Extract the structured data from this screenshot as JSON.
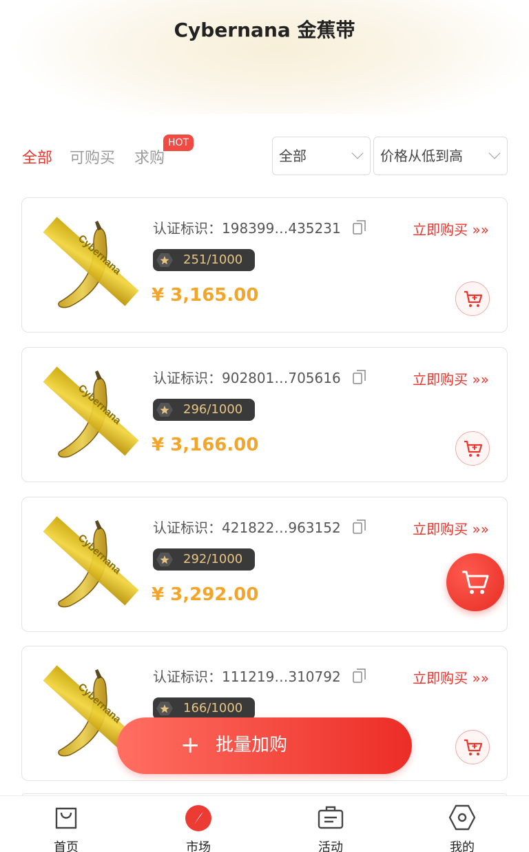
{
  "header": {
    "title": "Cybernana 金蕉带"
  },
  "tabs": [
    {
      "label": "全部",
      "active": true
    },
    {
      "label": "可购买",
      "active": false
    },
    {
      "label": "求购",
      "active": false,
      "badge": "HOT"
    }
  ],
  "filters": {
    "category": {
      "selected": "全部"
    },
    "sort": {
      "selected": "价格从低到高"
    }
  },
  "listings": [
    {
      "cert_label": "认证标识：",
      "cert_id": "198399…435231",
      "edition": "251/1000",
      "price": "¥ 3,165.00",
      "buy_label": "立即购买"
    },
    {
      "cert_label": "认证标识：",
      "cert_id": "902801…705616",
      "edition": "296/1000",
      "price": "¥ 3,166.00",
      "buy_label": "立即购买"
    },
    {
      "cert_label": "认证标识：",
      "cert_id": "421822…963152",
      "edition": "292/1000",
      "price": "¥ 3,292.00",
      "buy_label": "立即购买"
    },
    {
      "cert_label": "认证标识：",
      "cert_id": "111219…310792",
      "edition": "166/1000",
      "price": "",
      "buy_label": "立即购买"
    }
  ],
  "banana_text": "Cybernana",
  "batch_button": {
    "plus": "+",
    "label": "批量加购"
  },
  "nav": [
    {
      "label": "首页",
      "icon": "bag-icon"
    },
    {
      "label": "市场",
      "icon": "compass-icon",
      "active": true
    },
    {
      "label": "活动",
      "icon": "briefcase-icon"
    },
    {
      "label": "我的",
      "icon": "hexagon-icon"
    }
  ],
  "colors": {
    "accent": "#e8362f",
    "price": "#f3a52a",
    "badge_bg": "#3a3a3a",
    "badge_text": "#e8c585"
  }
}
